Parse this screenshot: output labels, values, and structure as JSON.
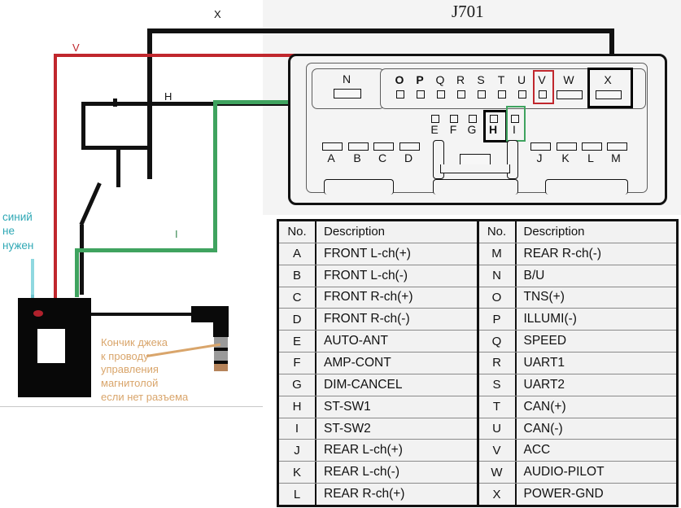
{
  "title": "J701",
  "colors": {
    "wire_black": "#111111",
    "wire_red": "#c0272d",
    "wire_green": "#3fa35f",
    "wire_blue": "#8fd8e0",
    "annotation_blue": "#2fa8b5",
    "annotation_orange": "#d9a56b",
    "panel_gray": "#f4f4f4",
    "led_red": "#b0212c"
  },
  "wire_labels": [
    {
      "id": "x",
      "text": "X",
      "color": "black"
    },
    {
      "id": "v",
      "text": "V",
      "color": "red"
    },
    {
      "id": "h",
      "text": "H",
      "color": "black"
    },
    {
      "id": "i",
      "text": "I",
      "color": "green"
    }
  ],
  "connector": {
    "top_row": [
      "N",
      "O",
      "P",
      "Q",
      "R",
      "S",
      "T",
      "U",
      "V",
      "W",
      "X"
    ],
    "mid_row": [
      "E",
      "F",
      "G",
      "H",
      "I"
    ],
    "bottom_row_left": [
      "A",
      "B",
      "C",
      "D"
    ],
    "bottom_row_right": [
      "J",
      "K",
      "L",
      "M"
    ],
    "highlighted_pins": [
      {
        "pin": "V",
        "color": "red"
      },
      {
        "pin": "X",
        "color": "black"
      },
      {
        "pin": "H",
        "color": "black"
      },
      {
        "pin": "I",
        "color": "green"
      }
    ]
  },
  "annotations": {
    "blue_note": [
      "синий",
      "не",
      "нужен"
    ],
    "orange_note": [
      "Кончик джека",
      "к проводу",
      "управления",
      "магнитолой",
      "если нет разъема"
    ]
  },
  "table": {
    "headers": {
      "no": "No.",
      "description": "Description"
    },
    "left": [
      {
        "no": "A",
        "desc": "FRONT L-ch(+)"
      },
      {
        "no": "B",
        "desc": "FRONT L-ch(-)"
      },
      {
        "no": "C",
        "desc": "FRONT R-ch(+)"
      },
      {
        "no": "D",
        "desc": "FRONT R-ch(-)"
      },
      {
        "no": "E",
        "desc": "AUTO-ANT"
      },
      {
        "no": "F",
        "desc": "AMP-CONT"
      },
      {
        "no": "G",
        "desc": "DIM-CANCEL"
      },
      {
        "no": "H",
        "desc": "ST-SW1"
      },
      {
        "no": "I",
        "desc": "ST-SW2"
      },
      {
        "no": "J",
        "desc": "REAR L-ch(+)"
      },
      {
        "no": "K",
        "desc": "REAR L-ch(-)"
      },
      {
        "no": "L",
        "desc": "REAR R-ch(+)"
      }
    ],
    "right": [
      {
        "no": "M",
        "desc": "REAR R-ch(-)"
      },
      {
        "no": "N",
        "desc": "B/U"
      },
      {
        "no": "O",
        "desc": "TNS(+)"
      },
      {
        "no": "P",
        "desc": "ILLUMI(-)"
      },
      {
        "no": "Q",
        "desc": "SPEED"
      },
      {
        "no": "R",
        "desc": "UART1"
      },
      {
        "no": "S",
        "desc": "UART2"
      },
      {
        "no": "T",
        "desc": "CAN(+)"
      },
      {
        "no": "U",
        "desc": "CAN(-)"
      },
      {
        "no": "V",
        "desc": "ACC"
      },
      {
        "no": "W",
        "desc": "AUDIO-PILOT"
      },
      {
        "no": "X",
        "desc": "POWER-GND"
      }
    ]
  }
}
